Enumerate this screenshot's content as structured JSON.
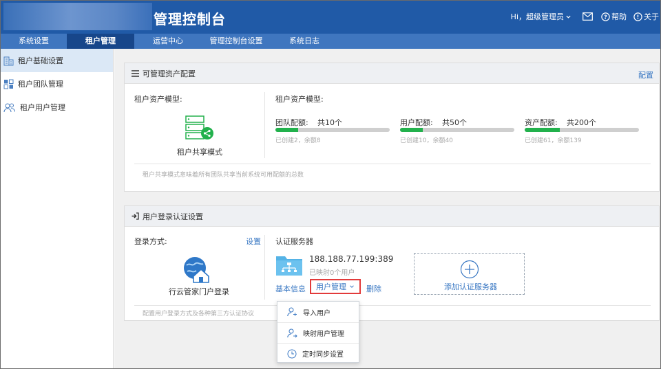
{
  "header": {
    "brand": "管理控制台",
    "greeting": "Hi，超级管理员",
    "help": "帮助",
    "about": "关于"
  },
  "nav": {
    "tabs": [
      {
        "label": "系统设置"
      },
      {
        "label": "租户管理"
      },
      {
        "label": "运营中心"
      },
      {
        "label": "管理控制台设置"
      },
      {
        "label": "系统日志"
      }
    ]
  },
  "sidebar": {
    "items": [
      {
        "label": "租户基础设置"
      },
      {
        "label": "租户团队管理"
      },
      {
        "label": "租户用户管理"
      }
    ]
  },
  "assets": {
    "title": "可管理资产配置",
    "action": "配置",
    "model_label_left": "租户资产模型:",
    "model_name": "租户共享模式",
    "model_label_right": "租户资产模型:",
    "quotas": [
      {
        "label": "团队配额:",
        "total": "共10个",
        "detail": "已创建2，余额8",
        "fraction": 0.2
      },
      {
        "label": "用户配额:",
        "total": "共50个",
        "detail": "已创建10，余额40",
        "fraction": 0.2
      },
      {
        "label": "资产配额:",
        "total": "共200个",
        "detail": "已创建61，余额139",
        "fraction": 0.305
      }
    ],
    "note": "租户共享模式意味着所有团队共享当前系统可用配额的总数"
  },
  "login": {
    "title": "用户登录认证设置",
    "method_label": "登录方式:",
    "method_action": "设置",
    "method_name": "行云管家门户登录",
    "server_label": "认证服务器",
    "server_ip": "188.188.77.199:389",
    "server_mapped": "已映射0个用户",
    "basic_info": "基本信息",
    "user_mgmt": "用户管理",
    "delete": "删除",
    "add_server": "添加认证服务器",
    "note": "配置用户登录方式及各种第三方认证协议"
  },
  "dropdown": {
    "items": [
      {
        "label": "导入用户"
      },
      {
        "label": "映射用户管理"
      },
      {
        "label": "定时同步设置"
      }
    ]
  },
  "colors": {
    "header": "#205aa7",
    "nav": "#3f76bf",
    "nav_active": "#17468a",
    "link": "#3a78c3",
    "progress": "#22b14c",
    "highlight": "#e23a3a"
  }
}
